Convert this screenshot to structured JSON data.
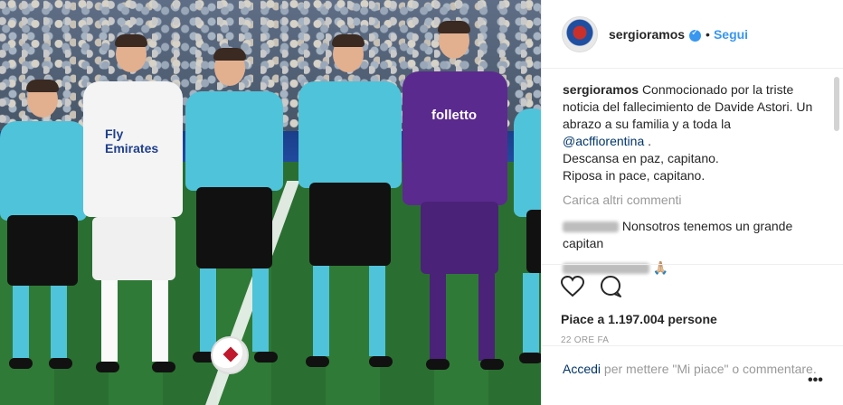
{
  "post": {
    "username": "sergioramos",
    "separator": "•",
    "follow_label": "Segui"
  },
  "caption": {
    "user": "sergioramos",
    "text_before_mention": "Conmocionado por la triste noticia del fallecimiento de Davide Astori. Un abrazo a su familia y a toda la",
    "mention": "@acffiorentina",
    "text_after_mention": ".",
    "line2": "Descansa en paz, capitano.",
    "line3": "Riposa in pace, capitano."
  },
  "load_more": "Carica altri commenti",
  "comments": [
    {
      "text": "Nonsotros tenemos un grande capitan"
    },
    {
      "text": "🙏🏼"
    }
  ],
  "likes": "Piace a 1.197.004 persone",
  "time": "22 ORE FA",
  "add_comment": {
    "login": "Accedi",
    "rest": "per mettere \"Mi piace\" o commentare."
  },
  "more_options": "•••",
  "photo": {
    "sponsor1": "Fly Emirates",
    "sponsor2": "folletto"
  },
  "colors": {
    "link_blue": "#3897f0",
    "mention_blue": "#003569",
    "muted": "#999999"
  },
  "icons": [
    "heart-icon",
    "comment-icon",
    "verified-badge-icon"
  ]
}
